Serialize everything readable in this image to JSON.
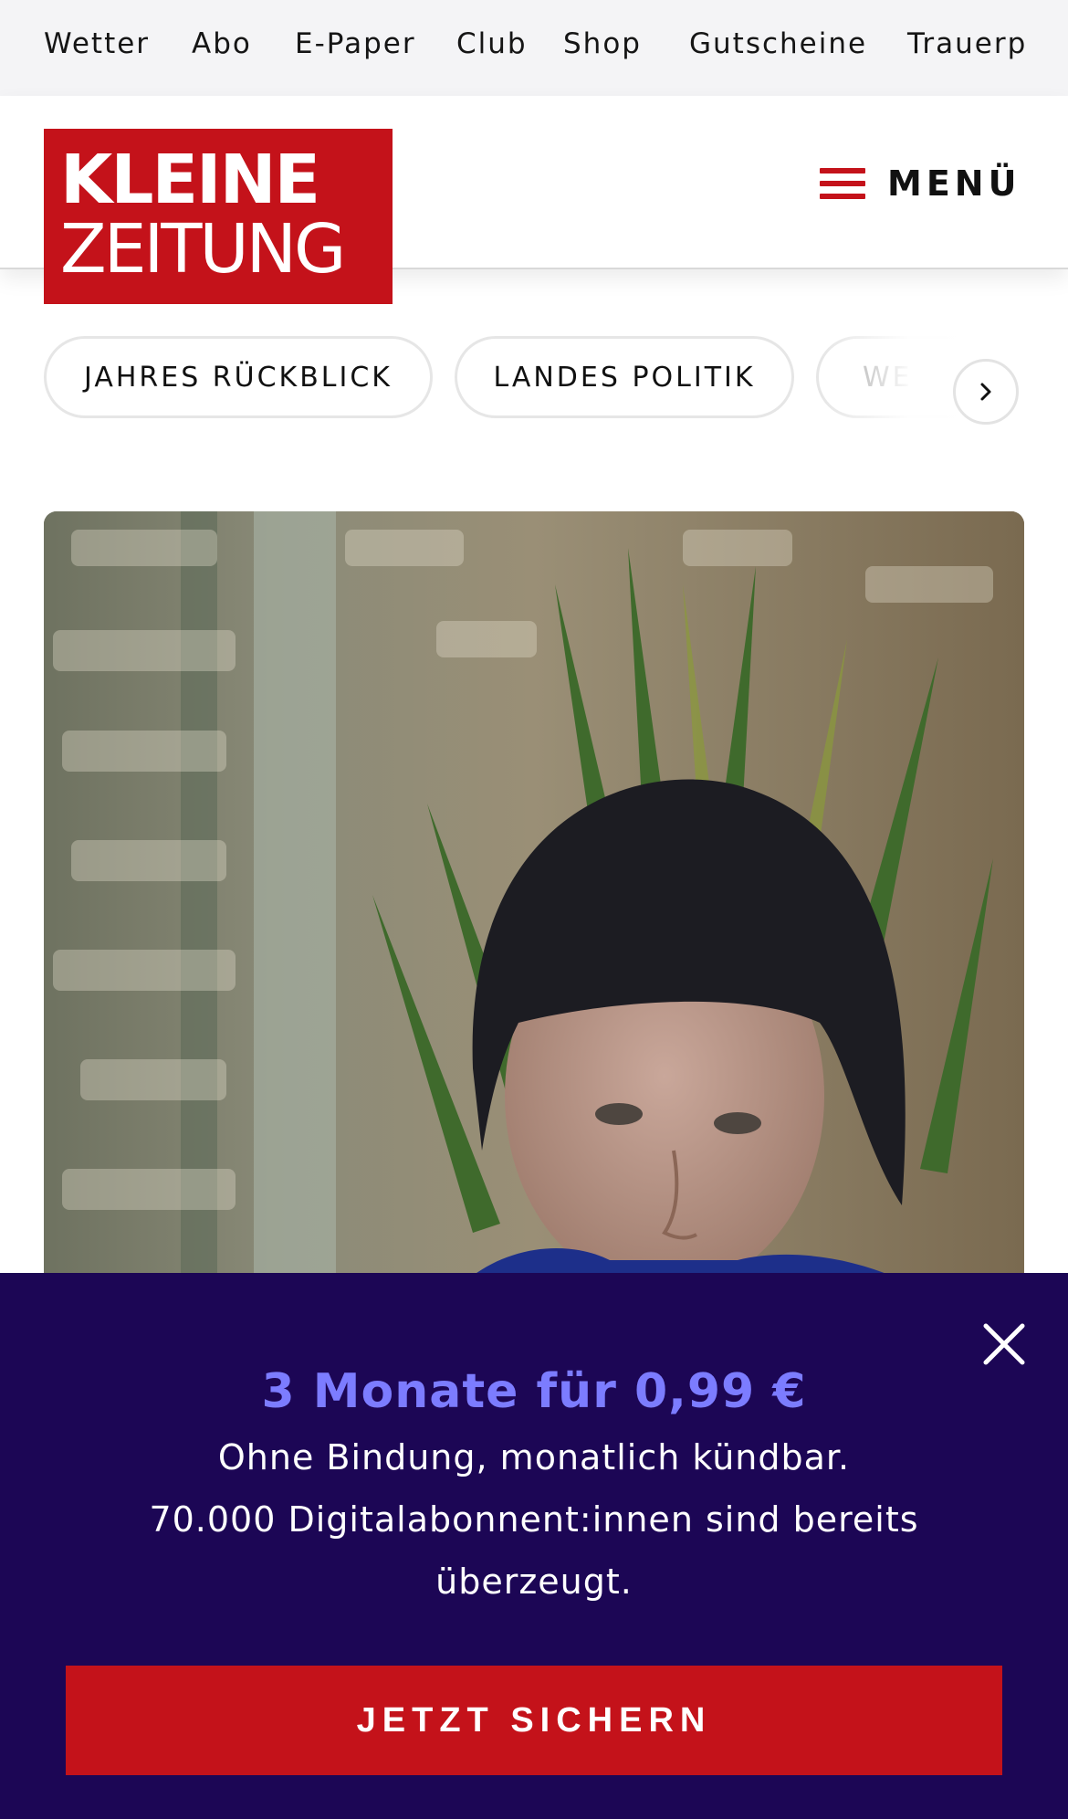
{
  "topnav": {
    "items": [
      "Wetter",
      "Abo",
      "E-Paper",
      "Club",
      "Shop",
      "Gutscheine",
      "Trauerp"
    ]
  },
  "header": {
    "logo_line1": "KLEINE",
    "logo_line2": "ZEITUNG",
    "menu_label": "MENÜ"
  },
  "tags": {
    "items": [
      "JAHRES RÜCKBLICK",
      "LANDES POLITIK",
      "WE"
    ]
  },
  "hero": {
    "icon": "photo-portrait"
  },
  "paywall": {
    "title": "3 Monate für 0,99 €",
    "line1": "Ohne Bindung, monatlich kündbar.",
    "line2": "70.000 Digitalabonnent:innen sind bereits",
    "line3": "überzeugt.",
    "cta_label": "JETZT SICHERN"
  },
  "colors": {
    "brand_red": "#c4121a",
    "paywall_bg": "#1c0655",
    "offer_accent": "#7c7cff"
  }
}
